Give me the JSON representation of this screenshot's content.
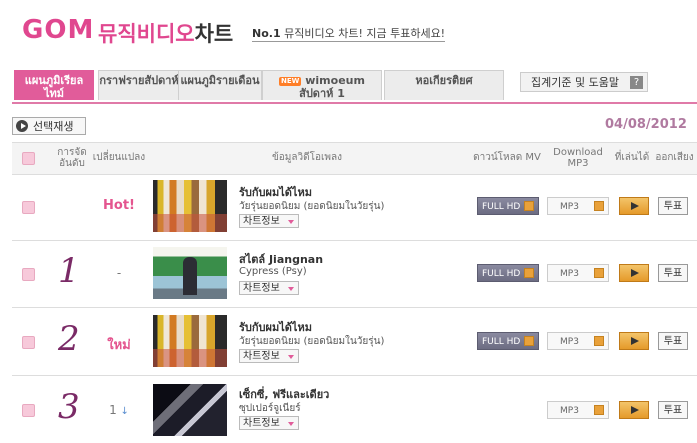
{
  "header": {
    "logo": "GOM",
    "subtitle_pink": "뮤직비디오",
    "subtitle_dark": "차트",
    "slogan_no": "No.1",
    "slogan_rest": " 뮤직비디오 차트! 지금 투표하세요!"
  },
  "tabs": [
    {
      "label": "แผนภูมิเรียลไทม์",
      "active": true
    },
    {
      "label": "กราฟรายสัปดาห์",
      "active": false
    },
    {
      "label": "แผนภูมิรายเดือน",
      "active": false
    },
    {
      "label": "wimoeum สัปดาห์ 1",
      "badge": "NEW",
      "active": false
    },
    {
      "label": "หอเกียรติยศ",
      "active": false
    }
  ],
  "help_button": {
    "label": "집계기준 및 도움말",
    "icon": "?"
  },
  "toolbar": {
    "play_selected": "선택재생",
    "date": "04/08/2012"
  },
  "table_header": {
    "rank": "การจัดอันดับ",
    "change": "เปลี่ยนแปลง",
    "info": "ข้อมูลวิดีโอเพลง",
    "download_mv": "ดาวน์โหลด MV",
    "download_mp3": "Download MP3",
    "play": "ที่เล่นได้",
    "vote": "ออกเสียง"
  },
  "rows": [
    {
      "rank": "",
      "change": "Hot!",
      "title": "รับกับผมได้ไหม",
      "artist": "วัยรุ่นยอดนิยม (ยอดนิยมในวัยรุ่น)",
      "info": "차트정보",
      "fullhd": "FULL HD",
      "mp3": "MP3",
      "vote": "투표"
    },
    {
      "rank": "1",
      "change": "-",
      "title": "สไตล์ Jiangnan",
      "artist": "Cypress (Psy)",
      "info": "차트정보",
      "fullhd": "FULL HD",
      "mp3": "MP3",
      "vote": "투표"
    },
    {
      "rank": "2",
      "change": "ใหม่",
      "title": "รับกับผมได้ไหม",
      "artist": "วัยรุ่นยอดนิยม (ยอดนิยมในวัยรุ่น)",
      "info": "차트정보",
      "fullhd": "FULL HD",
      "mp3": "MP3",
      "vote": "투표"
    },
    {
      "rank": "3",
      "change": "1",
      "change_dir": "↓",
      "title": "เซ็กซี่, ฟรีและเดียว",
      "artist": "ซุปเปอร์จูเนียร์",
      "info": "차트정보",
      "mp3": "MP3",
      "vote": "투표"
    }
  ],
  "colors": {
    "accent": "#e15c9a",
    "rank": "#7a2a66"
  }
}
